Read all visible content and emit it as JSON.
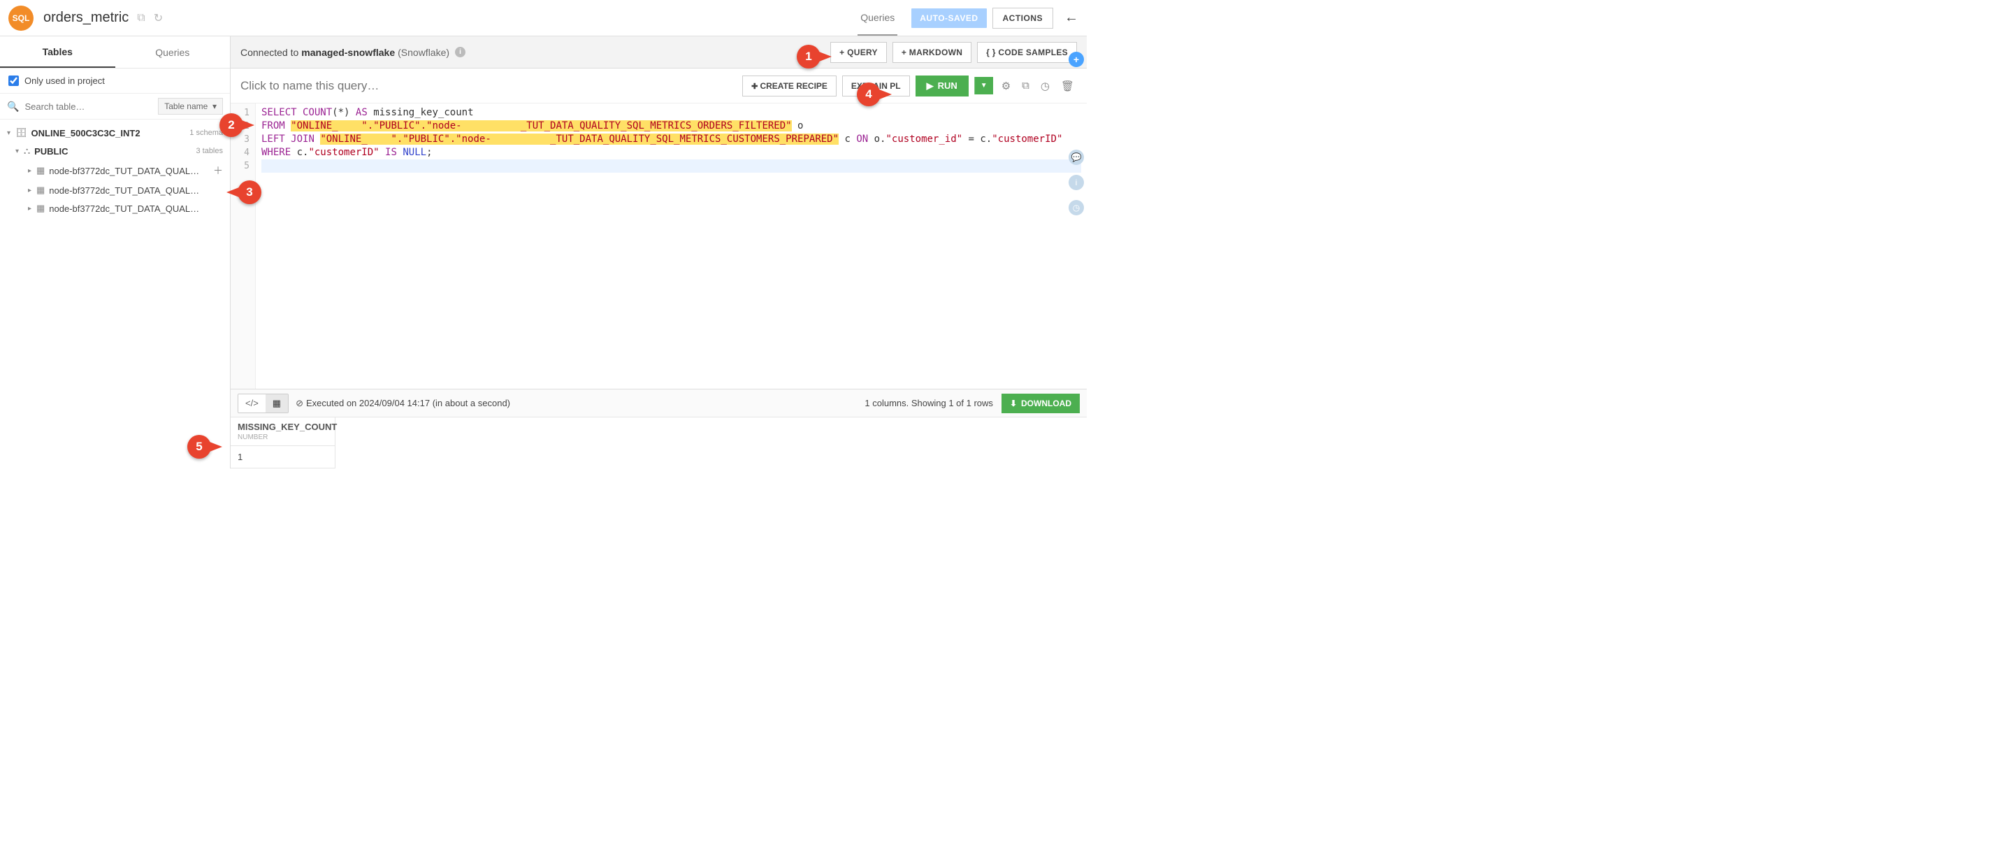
{
  "header": {
    "badge": "SQL",
    "title": "orders_metric",
    "queries_link": "Queries",
    "auto_saved": "AUTO-SAVED",
    "actions": "ACTIONS"
  },
  "sidebar": {
    "tabs": {
      "tables": "Tables",
      "queries": "Queries"
    },
    "filter_label": "Only used in project",
    "search_placeholder": "Search table…",
    "tablename_label": "Table name",
    "tree": {
      "db_name": "ONLINE_500C3C3C_INT2",
      "db_meta": "1 schema",
      "schema_name": "PUBLIC",
      "schema_meta": "3 tables",
      "tables": [
        "node-bf3772dc_TUT_DATA_QUAL…",
        "node-bf3772dc_TUT_DATA_QUAL…",
        "node-bf3772dc_TUT_DATA_QUAL…"
      ]
    }
  },
  "conn_bar": {
    "prefix": "Connected to",
    "name": "managed-snowflake",
    "type": "(Snowflake)",
    "add_query": "+ QUERY",
    "add_markdown": "+ MARKDOWN",
    "code_samples": "{ }  CODE SAMPLES"
  },
  "query_toolbar": {
    "placeholder": "Click to name this query…",
    "create_recipe": "CREATE RECIPE",
    "explain": "EXPLAIN PL",
    "run": "RUN"
  },
  "code": {
    "line1_a": "SELECT",
    "line1_b": "COUNT",
    "line1_c": "(*)",
    "line1_d": "AS",
    "line1_e": "missing_key_count",
    "line2_a": "FROM",
    "line2_b": "\"ONLINE_    \".\"PUBLIC\".\"node-          _TUT_DATA_QUALITY_SQL_METRICS_ORDERS_FILTERED\"",
    "line2_c": " o",
    "line3_a": "LEFT",
    "line3_b": "JOIN",
    "line3_c": "\"ONLINE_    \".\"PUBLIC\".\"node-          _TUT_DATA_QUALITY_SQL_METRICS_CUSTOMERS_PREPARED\"",
    "line3_d": " c ",
    "line3_e": "ON",
    "line3_f": " o.",
    "line3_g": "\"customer_id\"",
    "line3_h": " = c.",
    "line3_i": "\"customerID\"",
    "line4_a": "WHERE",
    "line4_b": " c.",
    "line4_c": "\"customerID\"",
    "line4_d": "IS",
    "line4_e": "NULL",
    "line4_f": ";"
  },
  "results": {
    "executed_text": "Executed on 2024/09/04 14:17 (in about a second)",
    "summary": "1 columns. Showing 1 of 1 rows",
    "download": "DOWNLOAD",
    "col_header": "MISSING_KEY_COUNT",
    "col_type": "NUMBER",
    "cell_value": "1"
  },
  "callouts": {
    "c1": "1",
    "c2": "2",
    "c3": "3",
    "c4": "4",
    "c5": "5"
  }
}
